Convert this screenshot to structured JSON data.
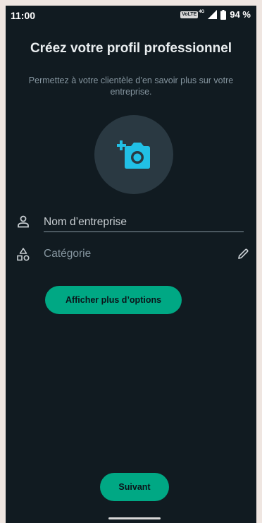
{
  "status_bar": {
    "time": "11:00",
    "volte": "VoLTE",
    "network": "4G",
    "battery": "94 %"
  },
  "header": {
    "title": "Créez votre profil professionnel",
    "subtitle": "Permettez à votre clientèle d’en savoir plus sur votre entreprise."
  },
  "form": {
    "business_name_placeholder": "Nom d’entreprise",
    "business_name_value": "",
    "category_label": "Catégorie"
  },
  "buttons": {
    "more_options": "Afficher plus d’options",
    "next": "Suivant"
  },
  "icons": {
    "photo": "camera-add-icon",
    "name": "person-icon",
    "category": "shapes-icon",
    "edit": "pencil-icon"
  },
  "colors": {
    "background": "#111b21",
    "accent": "#00a884",
    "photo_circle": "#2a3942",
    "camera_icon": "#21c0e6",
    "text_primary": "#e9edef",
    "text_secondary": "#8696a0",
    "frame": "#efe6e1"
  }
}
